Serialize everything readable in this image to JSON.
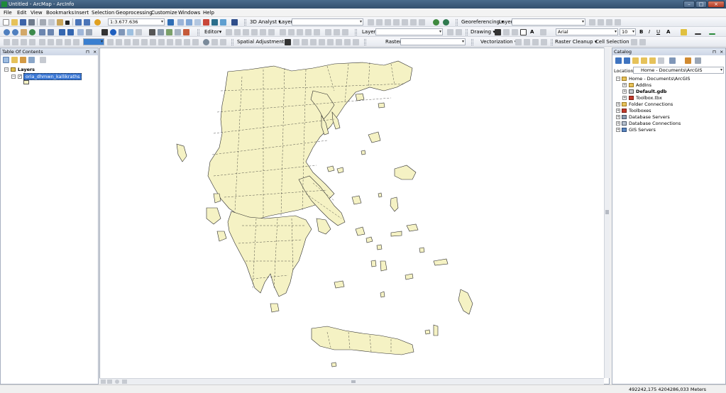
{
  "window": {
    "title": "Untitled - ArcMap - ArcInfo"
  },
  "menubar": {
    "items": [
      "File",
      "Edit",
      "View",
      "Bookmarks",
      "Insert",
      "Selection",
      "Geoprocessing",
      "Customize",
      "Windows",
      "Help"
    ]
  },
  "toolbar": {
    "scale": "1:3.677.636",
    "analyst3d_label": "3D Analyst ▾",
    "layer_label_1": "Layer:",
    "layer_label_2": "Layer:",
    "layer_label_3": "Layer:",
    "georeferencing_label": "Georeferencing ▾",
    "editor_label": "Editor▾",
    "drawing_label": "Drawing ▾",
    "font_name": "Arial",
    "font_size": "10",
    "bold": "B",
    "italic": "I",
    "underline": "U",
    "font_color_letter": "A",
    "spatial_adjustment_label": "Spatial Adjustment ▾",
    "raster_label": "Raster:",
    "vectorization_label": "Vectorization ▾",
    "raster_cleanup_label": "Raster Cleanup ▾",
    "cell_selection_label": "Cell Selection ▾"
  },
  "toc": {
    "title": "Table Of Contents",
    "pin": "⊓",
    "close": "×",
    "root_label": "Layers",
    "layer_name": "oria_dhmwn_kallikraths",
    "layer_checked": true
  },
  "catalog": {
    "title": "Catalog",
    "pin": "⊓",
    "close": "×",
    "location_label": "Location:",
    "location_value": "Home - Documents\\ArcGIS",
    "home_label": "Home - Documents\\ArcGIS",
    "items": [
      {
        "label": "AddIns",
        "icon": "folder-icon",
        "bold": false
      },
      {
        "label": "Default.gdb",
        "icon": "geodatabase-icon",
        "bold": true
      },
      {
        "label": "Toolbox.tbx",
        "icon": "toolbox-icon",
        "bold": false
      }
    ],
    "roots": [
      {
        "label": "Folder Connections",
        "icon": "folder-connections-icon"
      },
      {
        "label": "Toolboxes",
        "icon": "toolboxes-icon"
      },
      {
        "label": "Database Servers",
        "icon": "database-servers-icon"
      },
      {
        "label": "Database Connections",
        "icon": "database-connections-icon"
      },
      {
        "label": "GIS Servers",
        "icon": "gis-servers-icon"
      }
    ]
  },
  "map": {
    "fill_color": "#f5f2c4",
    "stroke_color": "#2a2a2a"
  },
  "status": {
    "coordinates": "492242,175  4204286,033 Meters"
  }
}
